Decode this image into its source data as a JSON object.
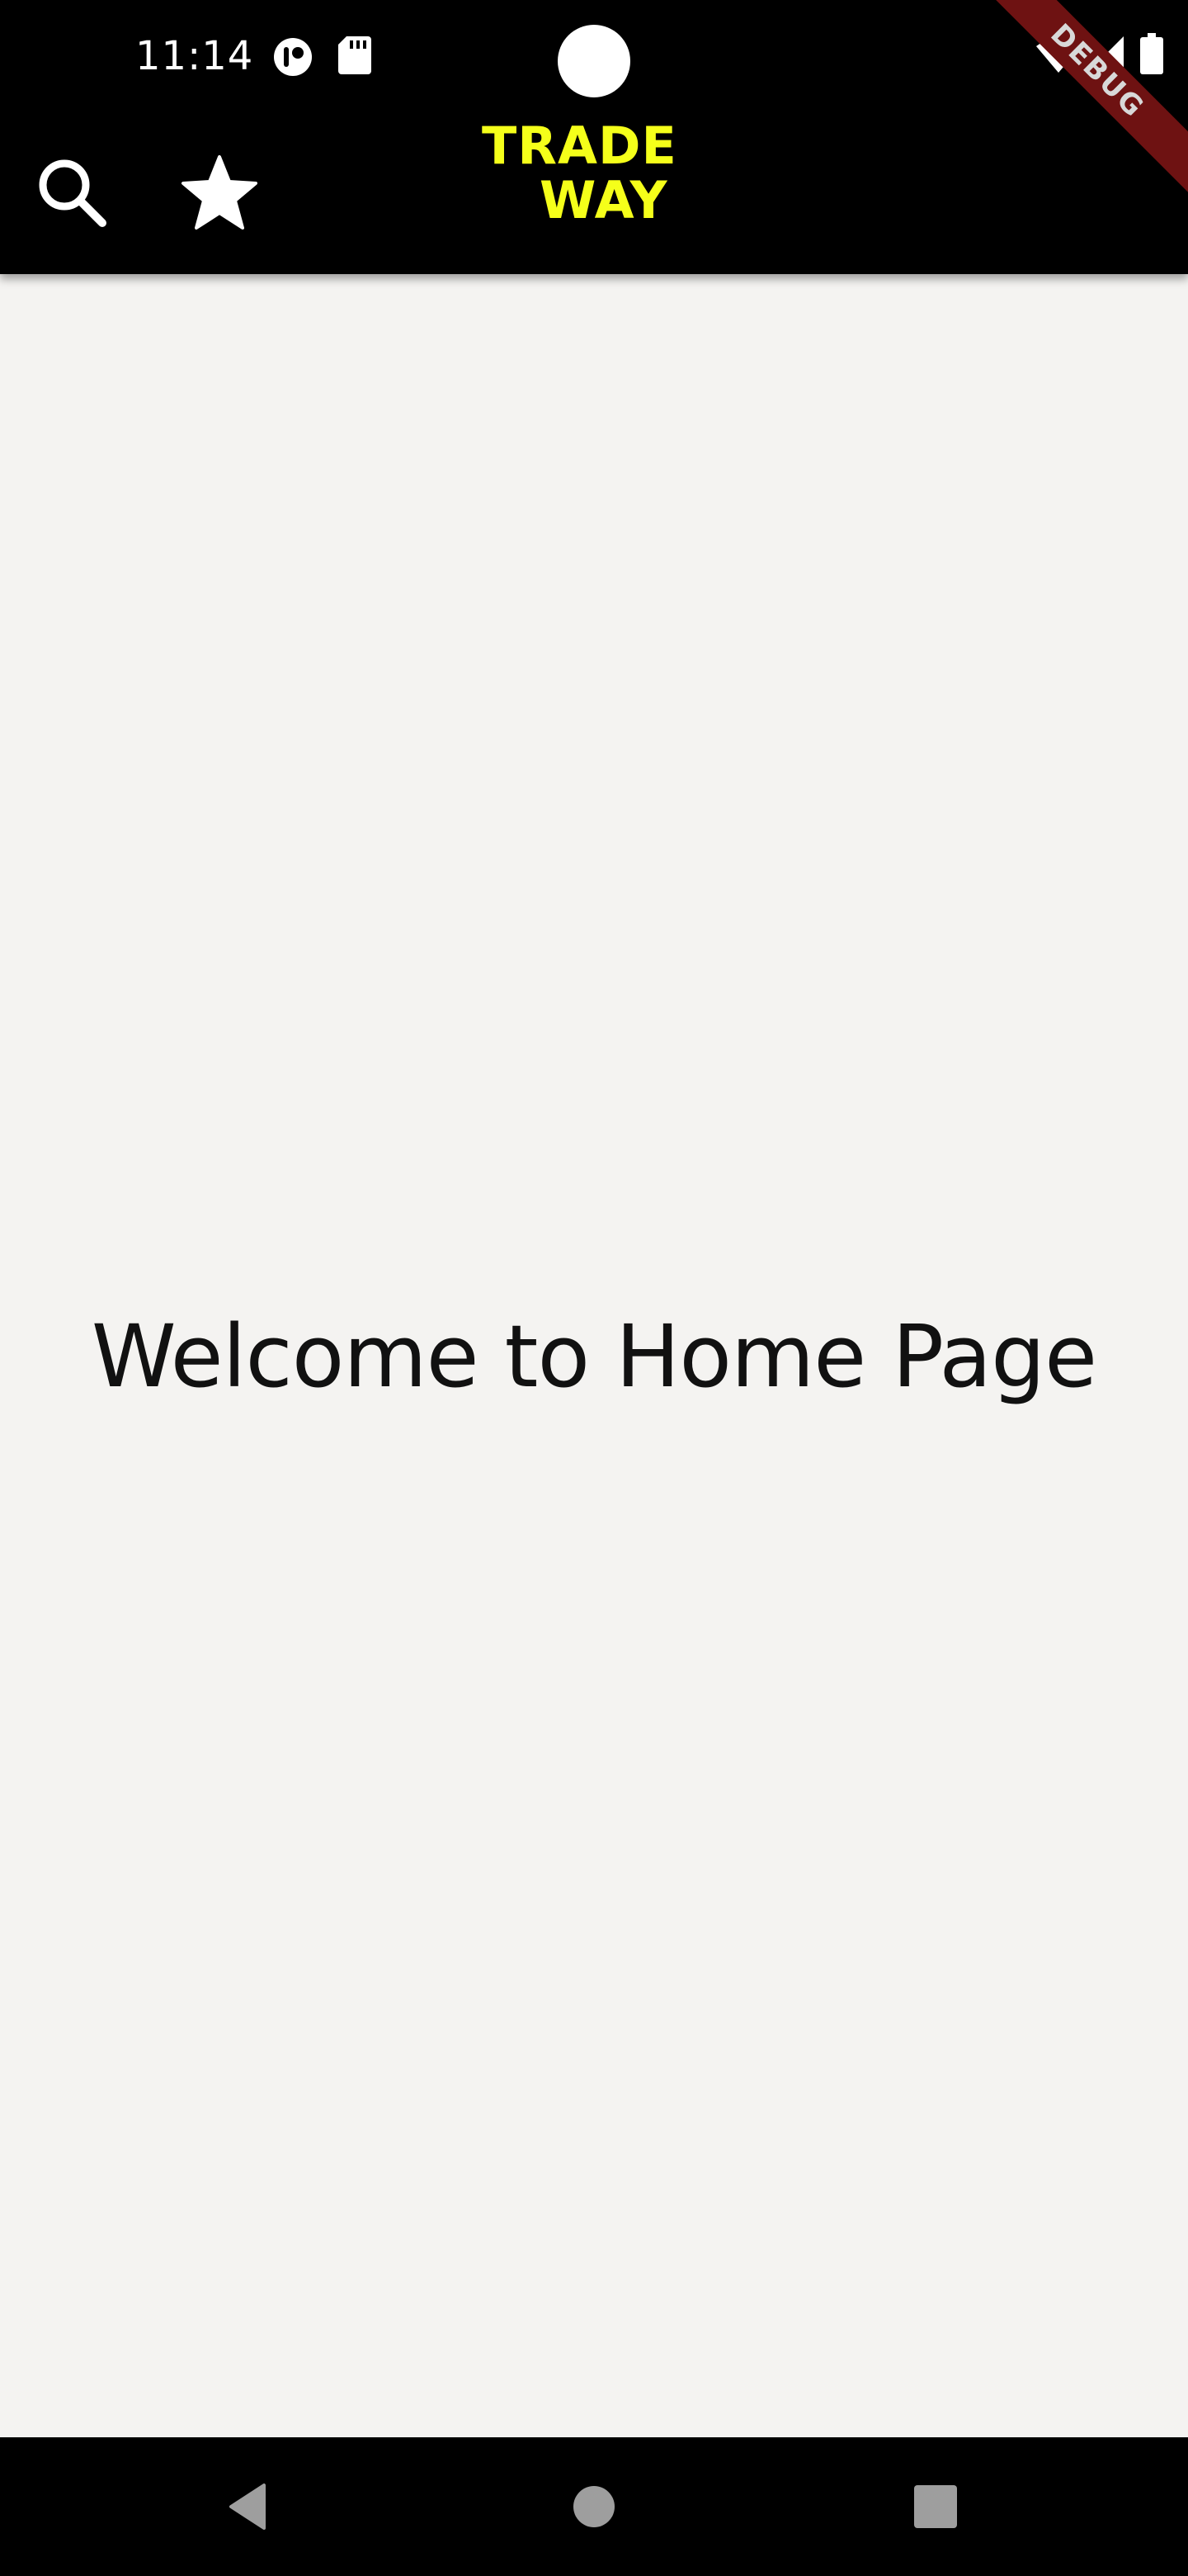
{
  "status_bar": {
    "time": "11:14",
    "icons": [
      "assistant-icon",
      "sd-card-icon",
      "wifi-icon",
      "signal-icon",
      "battery-icon"
    ]
  },
  "app_bar": {
    "search_icon": "search-icon",
    "favorite_icon": "star-icon",
    "logo_line1": "TRADE",
    "logo_line2": "WAY",
    "logo_color": "#f5ff1a"
  },
  "debug_banner": {
    "label": "DEBUG",
    "color": "#6e1212"
  },
  "main": {
    "welcome_text": "Welcome to Home Page",
    "background": "#f4f3f1"
  },
  "nav_bar": {
    "icons": [
      "back-icon",
      "home-icon",
      "recents-icon"
    ]
  }
}
